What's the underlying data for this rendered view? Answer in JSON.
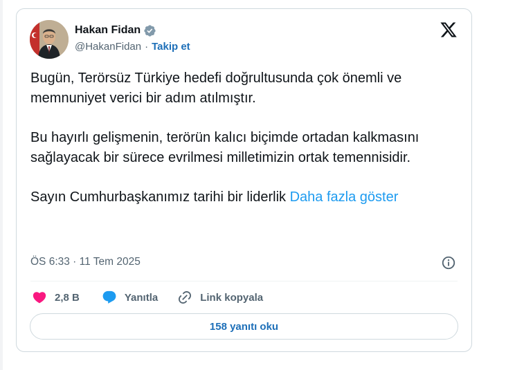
{
  "author": {
    "name": "Hakan Fidan",
    "handle": "@HakanFidan",
    "separator": "·",
    "follow_label": "Takip et",
    "verified_color": "#829aab"
  },
  "tweet": {
    "paragraphs": [
      "Bugün, Terörsüz Türkiye hedefi doğrultusunda çok önemli ve memnuniyet verici bir adım atılmıştır.",
      "Bu hayırlı gelişmenin, terörün kalıcı biçimde ortadan kalkmasını sağlayacak bir sürece evrilmesi milletimizin ortak temennisidir.",
      "Sayın Cumhurbaşkanımız tarihi bir liderlik"
    ],
    "show_more": "Daha fazla göster",
    "timestamp": "ÖS 6:33 · 11 Tem 2025"
  },
  "actions": {
    "like_count": "2,8 B",
    "reply_label": "Yanıtla",
    "copy_link_label": "Link kopyala"
  },
  "read_replies_label": "158 yanıtı oku",
  "colors": {
    "like": "#f91880",
    "reply": "#1d9bf0",
    "link": "#1d6fb8",
    "text": "#0f1419",
    "muted": "#536471"
  },
  "icons": [
    "verified-badge-icon",
    "x-logo-icon",
    "info-icon",
    "heart-icon",
    "reply-bubble-icon",
    "link-icon"
  ]
}
